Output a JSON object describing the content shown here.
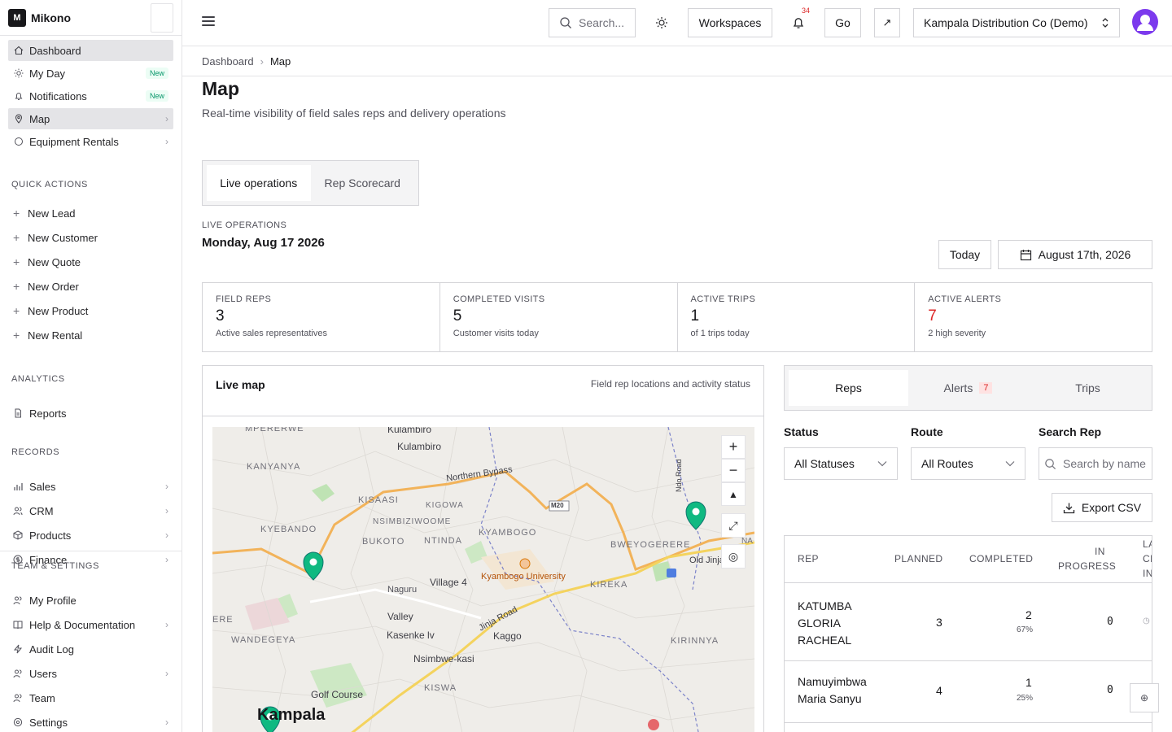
{
  "brand": {
    "logo_letter": "M",
    "name": "Mikono"
  },
  "nav": {
    "items": [
      {
        "label": "Dashboard",
        "icon": "home-icon"
      },
      {
        "label": "My Day",
        "badge": "New",
        "icon": "sun-icon"
      },
      {
        "label": "Notifications",
        "badge": "New",
        "icon": "bell-icon"
      },
      {
        "label": "Map",
        "icon": "map-pin-icon"
      },
      {
        "label": "Equipment Rentals",
        "icon": "circle-icon"
      }
    ]
  },
  "quick_actions": {
    "title": "QUICK ACTIONS",
    "items": [
      "New Lead",
      "New Customer",
      "New Quote",
      "New Order",
      "New Product",
      "New Rental"
    ]
  },
  "analytics": {
    "title": "ANALYTICS",
    "items": [
      "Reports"
    ]
  },
  "records": {
    "title": "RECORDS",
    "items": [
      "Sales",
      "CRM",
      "Products",
      "Finance"
    ]
  },
  "team": {
    "title": "TEAM & SETTINGS",
    "items": [
      "My Profile",
      "Help & Documentation",
      "Audit Log",
      "Users",
      "Team",
      "Settings"
    ]
  },
  "topbar": {
    "search_placeholder": "Search...",
    "workspaces": "Workspaces",
    "notification_count": "34",
    "go": "Go",
    "company": "Kampala Distribution Co (Demo)"
  },
  "breadcrumb": {
    "parent": "Dashboard",
    "current": "Map"
  },
  "page": {
    "title": "Map",
    "subtitle": "Real-time visibility of field sales reps and delivery operations",
    "tabs": [
      "Live operations",
      "Rep Scorecard"
    ],
    "live_label": "LIVE OPERATIONS",
    "live_date": "Monday, Aug 17 2026",
    "today": "Today",
    "date_picker": "August 17th, 2026"
  },
  "stats": [
    {
      "label": "FIELD REPS",
      "value": "3",
      "desc": "Active sales representatives"
    },
    {
      "label": "COMPLETED VISITS",
      "value": "5",
      "desc": "Customer visits today"
    },
    {
      "label": "ACTIVE TRIPS",
      "value": "1",
      "desc": "of 1 trips today"
    },
    {
      "label": "ACTIVE ALERTS",
      "value": "7",
      "desc": "2 high severity"
    }
  ],
  "map": {
    "title": "Live map",
    "desc": "Field rep locations and activity status",
    "labels": [
      "MPERERWE",
      "Kulambiro",
      "Kulambiro",
      "KANYANYA",
      "Northern Bypass",
      "KISAASI",
      "KIGOWA",
      "M20",
      "NSIMBIZIWOOME",
      "KYAMBOGO",
      "KYEBANDO",
      "BUKOTO",
      "NTINDA",
      "BWEYOGERERE",
      "Old Jinja",
      "Kyambogo University",
      "Naguru",
      "Village 4",
      "KIREKA",
      "ERE",
      "Valley",
      "Jinja Road",
      "WANDEGEYA",
      "Kasenke lv",
      "Kaggo",
      "KIRINNYA",
      "Nsimbwe-kasi",
      "Golf Course",
      "KISWA",
      "Kampala",
      "Ndo Road",
      "NA"
    ]
  },
  "right_panel": {
    "tabs": [
      {
        "label": "Reps"
      },
      {
        "label": "Alerts",
        "count": "7"
      },
      {
        "label": "Trips"
      }
    ],
    "filters": {
      "status_label": "Status",
      "status_value": "All Statuses",
      "route_label": "Route",
      "route_value": "All Routes",
      "search_label": "Search Rep",
      "search_placeholder": "Search by name"
    },
    "export": "Export CSV",
    "table": {
      "headers": [
        "REP",
        "PLANNED",
        "COMPLETED",
        "IN",
        "PROGRESS",
        "LA",
        "CH",
        "IN"
      ],
      "rows": [
        {
          "name1": "KATUMBA",
          "name2": "GLORIA",
          "name3": "RACHEAL",
          "planned": "3",
          "completed": "2",
          "pct": "67%",
          "in_progress": "0"
        },
        {
          "name1": "Namuyimbwa",
          "name2": "Maria Sanyu",
          "planned": "4",
          "completed": "1",
          "pct": "25%",
          "in_progress": "0"
        }
      ]
    }
  }
}
